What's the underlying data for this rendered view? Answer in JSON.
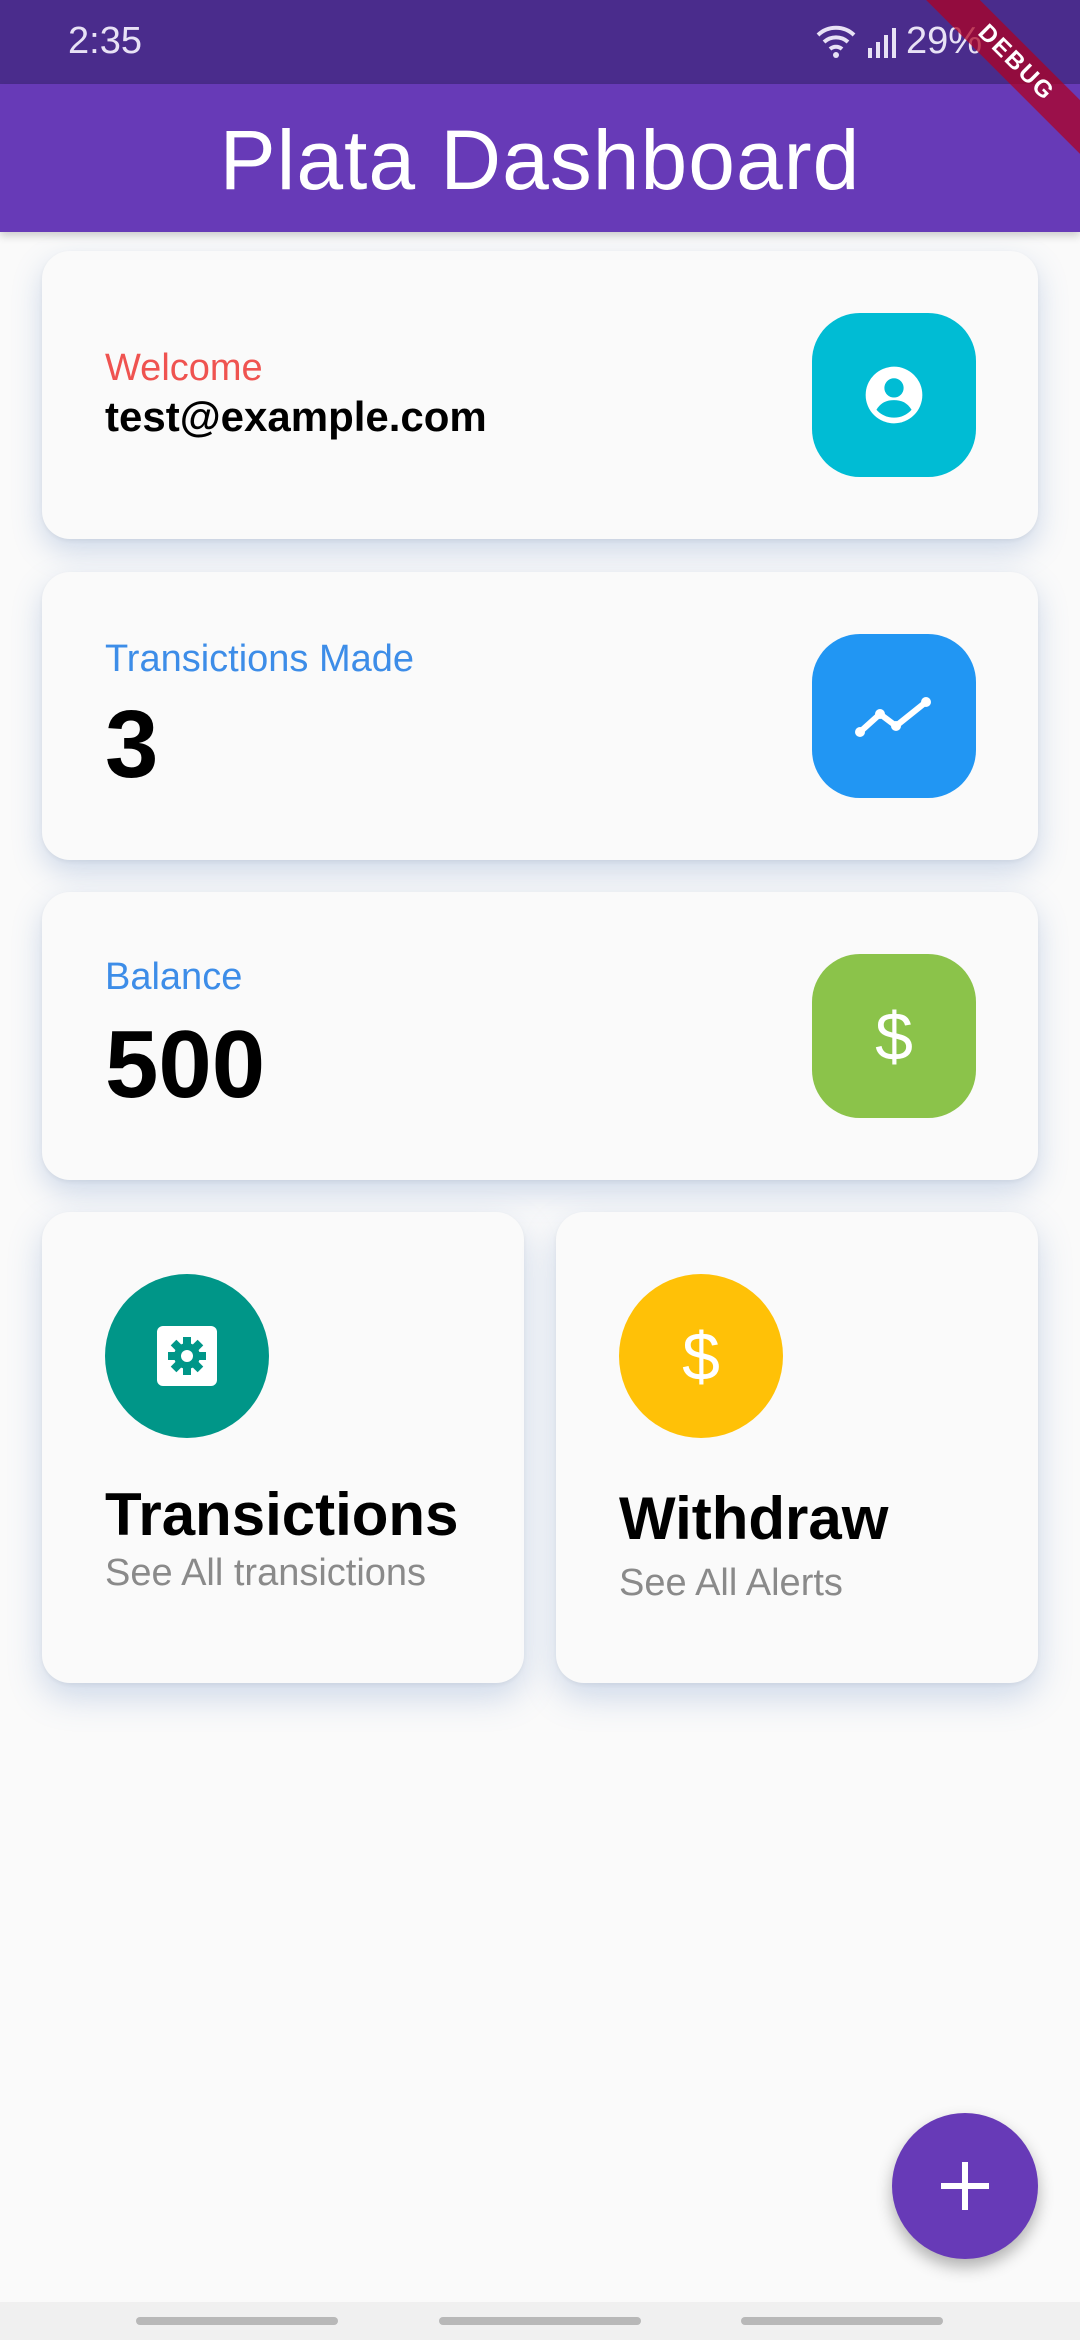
{
  "status_bar": {
    "time": "2:35",
    "battery": "29%"
  },
  "app_bar": {
    "title": "Plata Dashboard",
    "color": "#673ab7"
  },
  "debug_banner": "DEBUG",
  "cards": {
    "welcome": {
      "label": "Welcome",
      "value": "test@example.com",
      "icon": "account-circle-icon",
      "label_color": "#ef5350",
      "icon_bg": "#00bcd4"
    },
    "transactions": {
      "label": "Transictions Made",
      "value": "3",
      "icon": "trending-up-icon",
      "label_color": "#3d8de8",
      "icon_bg": "#2196f3"
    },
    "balance": {
      "label": "Balance",
      "value": "500",
      "icon": "dollar-icon",
      "label_color": "#3d8de8",
      "icon_bg": "#8bc34a"
    }
  },
  "tiles": {
    "transactions": {
      "title": "Transictions",
      "subtitle": "See All transictions",
      "icon": "settings-applications-icon",
      "icon_bg": "#009688"
    },
    "withdraw": {
      "title": "Withdraw",
      "subtitle": "See All Alerts",
      "icon": "dollar-icon",
      "icon_bg": "#ffc107"
    }
  },
  "fab": {
    "icon": "plus-icon",
    "color": "#673ab7"
  }
}
